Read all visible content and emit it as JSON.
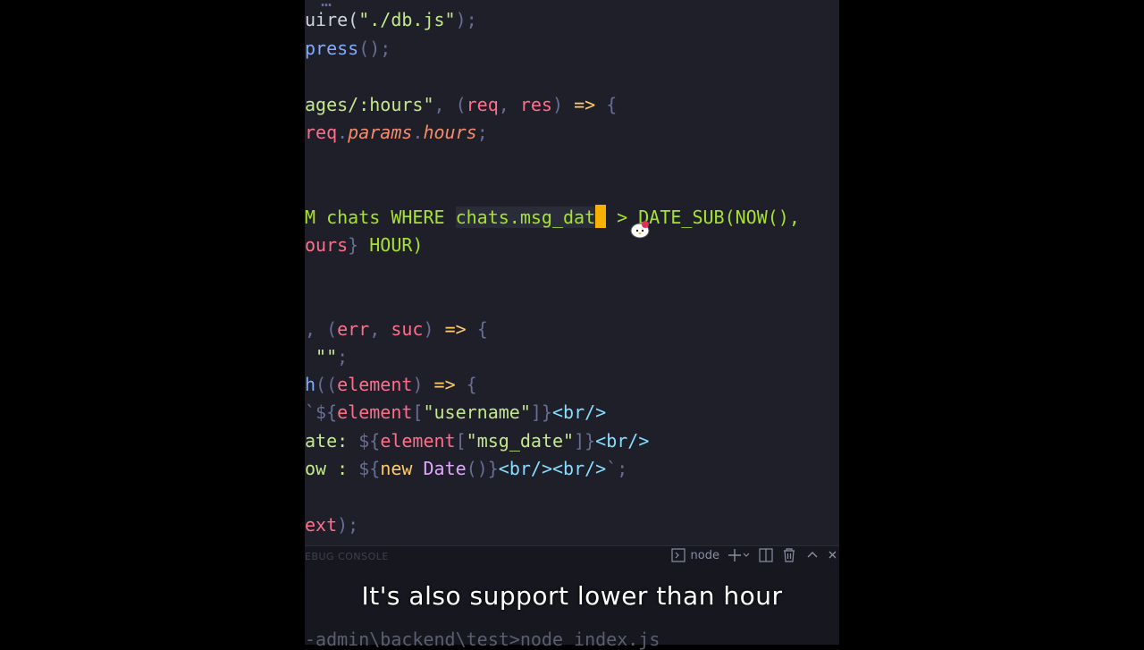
{
  "editor": {
    "top_fragment": "… ",
    "lines": [
      {
        "id": "l1",
        "parts": [
          [
            "",
            "uire("
          ],
          [
            "str",
            "\"./db.js\""
          ],
          [
            "punc",
            ");"
          ]
        ]
      },
      {
        "id": "l2",
        "parts": [
          [
            "fn",
            "press"
          ],
          [
            "punc",
            "();"
          ]
        ]
      },
      {
        "id": "l3",
        "parts": [
          [
            "str",
            "ages/:hours\""
          ],
          [
            "punc",
            ", ("
          ],
          [
            "var",
            "req"
          ],
          [
            "punc",
            ", "
          ],
          [
            "var",
            "res"
          ],
          [
            "punc",
            ") "
          ],
          [
            "op",
            "=>"
          ],
          [
            "punc",
            " {"
          ]
        ]
      },
      {
        "id": "l4",
        "parts": [
          [
            "var",
            "req"
          ],
          [
            "punc",
            "."
          ],
          [
            "prop",
            "params"
          ],
          [
            "punc",
            "."
          ],
          [
            "prop",
            "hours"
          ],
          [
            "punc",
            ";"
          ]
        ]
      },
      {
        "id": "l5",
        "parts": [
          [
            "sql",
            "M chats WHERE "
          ],
          [
            "sqlhl",
            "chats.msg_dat"
          ]
        ]
      },
      {
        "id": "l6",
        "parts": [
          [
            "var",
            "ours"
          ],
          [
            "punc",
            "} "
          ],
          [
            "sql",
            "HOUR)"
          ]
        ]
      },
      {
        "id": "l7",
        "parts": [
          [
            "punc",
            ", ("
          ],
          [
            "var",
            "err"
          ],
          [
            "punc",
            ", "
          ],
          [
            "var",
            "suc"
          ],
          [
            "punc",
            ") "
          ],
          [
            "op",
            "=>"
          ],
          [
            "punc",
            " {"
          ]
        ]
      },
      {
        "id": "l8",
        "parts": [
          [
            "punc",
            " "
          ],
          [
            "str",
            "\"\""
          ],
          [
            "punc",
            ";"
          ]
        ]
      },
      {
        "id": "l9",
        "parts": [
          [
            "fn",
            "h"
          ],
          [
            "punc",
            "(("
          ],
          [
            "var",
            "element"
          ],
          [
            "punc",
            ") "
          ],
          [
            "op",
            "=>"
          ],
          [
            "punc",
            " {"
          ]
        ]
      },
      {
        "id": "l10",
        "parts": [
          [
            "punc",
            "`${"
          ],
          [
            "var",
            "element"
          ],
          [
            "punc",
            "["
          ],
          [
            "str",
            "\"username\""
          ],
          [
            "punc",
            "]}"
          ],
          [
            "tag",
            "<br/>"
          ]
        ]
      },
      {
        "id": "l11",
        "parts": [
          [
            "str",
            "ate: "
          ],
          [
            "punc",
            "${"
          ],
          [
            "var",
            "element"
          ],
          [
            "punc",
            "["
          ],
          [
            "str",
            "\"msg_date\""
          ],
          [
            "punc",
            "]}"
          ],
          [
            "tag",
            "<br/>"
          ]
        ]
      },
      {
        "id": "l12",
        "parts": [
          [
            "str",
            "ow : "
          ],
          [
            "punc",
            "${"
          ],
          [
            "op",
            "new "
          ],
          [
            "par",
            "Date"
          ],
          [
            "punc",
            "()}"
          ],
          [
            "tag",
            "<br/><br/>"
          ],
          [
            "punc",
            "`;"
          ]
        ]
      },
      {
        "id": "l13",
        "parts": [
          [
            "var",
            "ext"
          ],
          [
            "punc",
            ");"
          ]
        ]
      }
    ],
    "line5_after_cursor": "> DATE_SUB(NOW(),"
  },
  "panel": {
    "tab_label": "EBUG CONSOLE",
    "terminal_name": "node",
    "terminal_line": "-admin\\backend\\test>node index.js"
  },
  "caption": "It's also support lower than hour",
  "colors": {
    "editor_bg": "#1e1f29",
    "cursor": "#f5b000",
    "caption": "#ffffff"
  }
}
